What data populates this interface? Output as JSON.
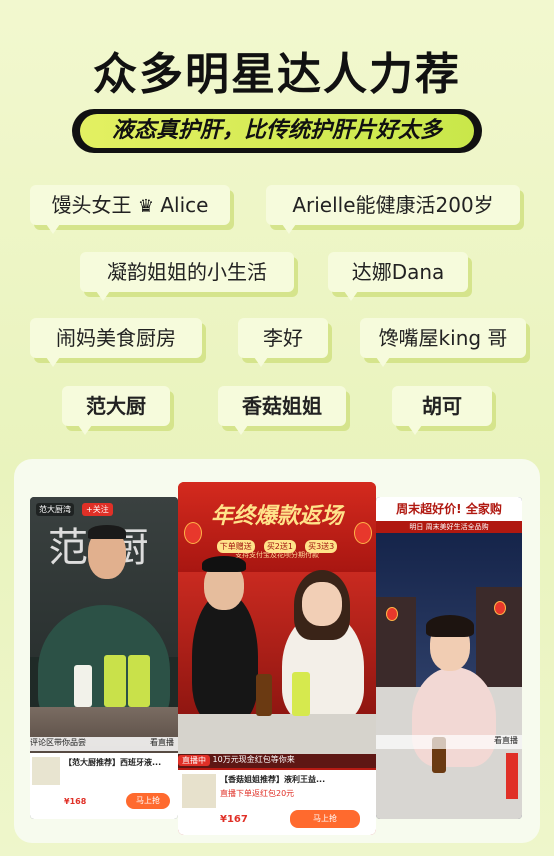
{
  "title": "众多明星达人力荐",
  "subtitle": "液态真护肝，比传统护肝片好太多",
  "influencers": [
    {
      "name": "馒头女王",
      "suffix": "Alice",
      "crown": "♛"
    },
    {
      "name": "Arielle能健康活200岁"
    },
    {
      "name": "凝韵姐姐的小生活"
    },
    {
      "name": "达娜Dana"
    },
    {
      "name": "闹妈美食厨房"
    },
    {
      "name": "李好"
    },
    {
      "name": "馋嘴屋king 哥"
    },
    {
      "name": "范大厨"
    },
    {
      "name": "香菇姐姐"
    },
    {
      "name": "胡可"
    }
  ],
  "cards": {
    "card1": {
      "badge": "范大厨湾",
      "follow": "+关注",
      "sign": "范 厨",
      "comment": "评论区带你品尝",
      "view": "看直播",
      "product": "【范大厨推荐】西班牙液...",
      "price": "¥168",
      "buy": "马上抢"
    },
    "card2": {
      "banner": "年终爆款返场",
      "tags": [
        "下单赠送",
        "买2送1",
        "买3送3"
      ],
      "note": "支持支付宝及花呗分期付款",
      "live_label": "直播中",
      "live_info": "10万元现金红包等你来",
      "product": "【香菇姐姐推荐】液利王益...",
      "promo": "直播下单返红包20元",
      "price": "¥167",
      "buy": "马上抢"
    },
    "card3": {
      "header": "周末超好价! 全家购",
      "sub": "明日  周末美好生活全品购",
      "view": "看直播"
    }
  },
  "colors": {
    "background": "#eef5c4",
    "accent": "#cde64c",
    "card_red": "#b81b14"
  }
}
